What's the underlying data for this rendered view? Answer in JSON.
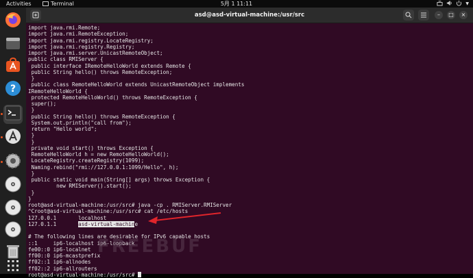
{
  "topbar": {
    "activities": "Activities",
    "app_name": "Terminal",
    "clock": "5月 1  11:11"
  },
  "dock": {
    "items": [
      {
        "name": "firefox-icon",
        "running": false
      },
      {
        "name": "files-icon",
        "running": false
      },
      {
        "name": "software-store-icon",
        "running": false
      },
      {
        "name": "help-icon",
        "running": false
      },
      {
        "name": "terminal-icon",
        "running": true
      },
      {
        "name": "updater-icon",
        "running": true
      },
      {
        "name": "settings-icon",
        "running": true
      },
      {
        "name": "disc-icon",
        "running": false
      },
      {
        "name": "disc-icon",
        "running": false
      },
      {
        "name": "disc-icon",
        "running": false
      },
      {
        "name": "trash-icon",
        "running": false
      },
      {
        "name": "show-apps-icon",
        "running": false
      }
    ]
  },
  "window": {
    "title": "asd@asd-virtual-machine:/usr/src"
  },
  "terminal": {
    "lines": [
      "import java.rmi.Remote;",
      "import java.rmi.RemoteException;",
      "import java.rmi.registry.LocateRegistry;",
      "import java.rmi.registry.Registry;",
      "import java.rmi.server.UnicastRemoteObject;",
      "public class RMIServer {",
      " public interface IRemoteHelloWorld extends Remote {",
      " public String hello() throws RemoteException;",
      " }",
      " public class RemoteHelloWorld extends UnicastRemoteObject implements",
      "IRemoteHelloWorld {",
      " protected RemoteHelloWorld() throws RemoteException {",
      " super();",
      " }",
      " public String hello() throws RemoteException {",
      " System.out.println(\"call from\");",
      " return \"Hello world\";",
      " }",
      " }",
      " private void start() throws Exception {",
      " RemoteHelloWorld h = new RemoteHelloWorld();",
      " LocateRegistry.createRegistry(1099);",
      " Naming.rebind(\"rmi://127.0.0.1:1099/Hello\", h);",
      " }",
      " public static void main(String[] args) throws Exception {",
      "         new RMIServer().start();",
      " }",
      "}",
      "root@asd-virtual-machine:/usr/src# java -cp . RMIServer.RMIServer",
      "^Croot@asd-virtual-machine:/usr/src# cat /etc/hosts",
      "127.0.0.1       localhost"
    ],
    "hosts_ip": "127.0.1.1       ",
    "hosts_name_selected": "asd-virtual-machin",
    "hosts_name_rest": "e",
    "lines_after": [
      "",
      "# The following lines are desirable for IPv6 capable hosts",
      "::1     ip6-localhost ip6-loopback",
      "fe00::0 ip6-localnet",
      "ff00::0 ip6-mcastprefix",
      "ff02::1 ip6-allnodes",
      "ff02::2 ip6-allrouters"
    ],
    "prompt": "root@asd-virtual-machine:/usr/src# "
  },
  "watermark": "FREEBUF",
  "colors": {
    "terminal_bg": "#300a24",
    "terminal_fg": "#e6e6e6",
    "arrow": "#e0252b",
    "dock_bg": "#202020",
    "topbar_bg": "#0b0b0b"
  }
}
